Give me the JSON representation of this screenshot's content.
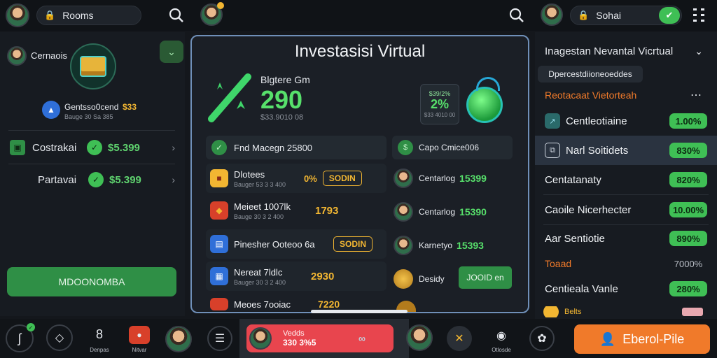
{
  "topbar": {
    "search_left_label": "Rooms",
    "search_right_label": "Sohai"
  },
  "left": {
    "profile_name": "Cernaois",
    "account_title": "Gentsso0cend",
    "account_amount": "$33",
    "account_sub": "Bauge 30 Sa 385",
    "rows": [
      {
        "label": "Costrakai",
        "value": "$5.399"
      },
      {
        "label": "Partavai",
        "value": "$5.399"
      }
    ],
    "button_label": "MDOONOMBA"
  },
  "center": {
    "title": "Investasisi Virtual",
    "hero_label": "Blgtere Gm",
    "hero_value": "290",
    "hero_sub": "$33.9010 08",
    "badge_top": "$39/2%",
    "badge_value": "2%",
    "badge_sub": "$33 4010 00",
    "left_header": "Fnd Macegn 25800",
    "right_header": "Capo Cmice006",
    "left_items": [
      {
        "title": "Dlotees",
        "sub": "Bauger 53 3 3 400",
        "value": "0%",
        "tag": "SODIN"
      },
      {
        "title": "Meieet 1007lk",
        "sub": "Bauge 30 3 2 400",
        "value": "1793",
        "tag": ""
      },
      {
        "title": "Pinesher Ooteoo 6a",
        "sub": "",
        "value": "",
        "tag": "SODIN"
      },
      {
        "title": "Nereat 7ldlc",
        "sub": "Bauger 30 3 2 400",
        "value": "2930",
        "tag": ""
      },
      {
        "title": "Meoes 7ooiac",
        "sub": "",
        "value": "7220",
        "tag": ""
      }
    ],
    "right_items": [
      {
        "title": "Centarlog",
        "value": "15399"
      },
      {
        "title": "Centarlog",
        "value": "15390"
      },
      {
        "title": "Karnetyo",
        "value": "15393"
      },
      {
        "title": "Desidy",
        "value": ""
      }
    ],
    "right_button": "JOOID en"
  },
  "right": {
    "header": "Inagestan Nevantal Vicrtual",
    "chip": "Dpercestdiioneoeddes",
    "sub_header": "Reotacaat Vietorteah",
    "rows": [
      {
        "label": "Centleotiaine",
        "value": "1.00%"
      },
      {
        "label": "Narl Soitidets",
        "value": "830%"
      },
      {
        "label": "Centatanaty",
        "value": "820%"
      },
      {
        "label": "Caoile Nicerhecter",
        "value": "10.00%"
      },
      {
        "label": "Aar Sentiotie",
        "value": "890%"
      },
      {
        "label": "Toaad",
        "value": "7000%"
      },
      {
        "label": "Centieala Vanle",
        "value": "280%"
      }
    ],
    "footer_label": "Belts"
  },
  "bottom": {
    "nav_labels": [
      "Denpas",
      "Nitvar"
    ],
    "active_card_title": "Vedds",
    "active_card_value": "330 3%5",
    "last_icon_label": "Otlosde",
    "cta": "Eberol-Pile"
  },
  "colors": {
    "accent_green": "#3fbf55",
    "cta_orange": "#f07a2a",
    "active_red": "#e8454e",
    "gold": "#f2b632"
  }
}
